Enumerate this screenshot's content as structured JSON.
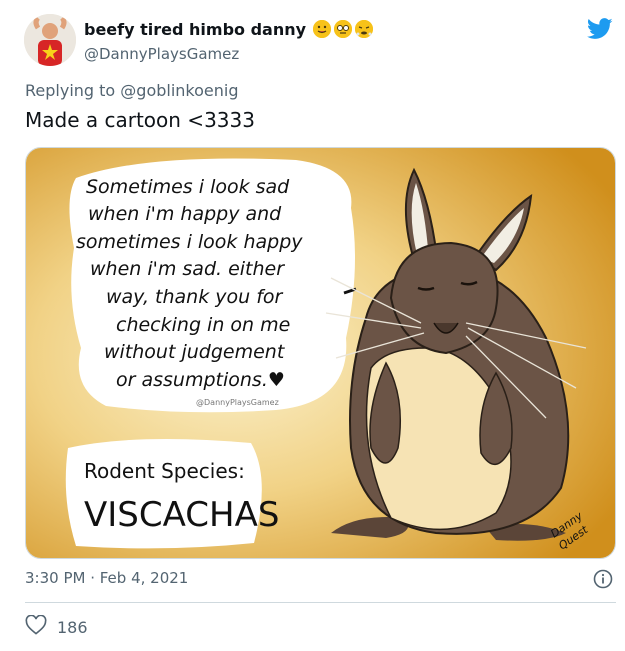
{
  "user": {
    "display_name": "beefy tired himbo danny",
    "handle": "@DannyPlaysGamez",
    "emoji_icons": [
      "face-with-tongue-icon",
      "nerd-face-icon",
      "steaming-face-icon"
    ]
  },
  "tweet": {
    "replying_prefix": "Replying to ",
    "replying_to": "@goblinkoenig",
    "text": "Made a cartoon <3333",
    "timestamp": "3:30 PM · Feb 4, 2021",
    "like_count": "186"
  },
  "media": {
    "speech_text_lines": [
      "Sometimes i look sad",
      "when i'm happy and",
      "sometimes i look happy",
      "when i'm sad. either",
      "way, thank you for",
      "checking in on me",
      "without judgement",
      "or assumptions.♥"
    ],
    "watermark": "@DannyPlaysGamez",
    "species_label": "Rodent Species:",
    "species_name": "VISCACHAS",
    "signature_line1": "Danny",
    "signature_line2": "Quest"
  },
  "colors": {
    "twitter_blue": "#1d9bf0",
    "card_bg_light": "#f8e9b8",
    "card_bg_dark": "#d79a2a",
    "rodent_brown": "#6b5446",
    "rodent_belly": "#f6e3b4"
  }
}
